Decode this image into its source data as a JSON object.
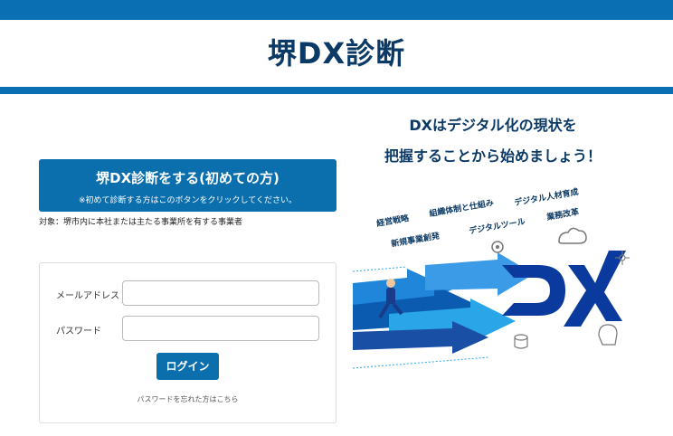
{
  "header": {
    "title": "堺DX診断"
  },
  "start": {
    "button_label": "堺DX診断をする(初めての方)",
    "button_sub": "※初めて診断する方はこのボタンをクリックしてください。",
    "target_note": "対象：堺市内に本社または主たる事業所を有する事業者"
  },
  "login": {
    "email_label": "メールアドレス",
    "password_label": "パスワード",
    "email_value": "",
    "password_value": "",
    "button_label": "ログイン",
    "forgot_link": "パスワードを忘れた方はこちら"
  },
  "promo": {
    "line1": "DXはデジタル化の現状を",
    "line2": "把握することから始めましょう！",
    "keywords": [
      "経営戦略",
      "組織体制と仕組み",
      "デジタル人材育成",
      "新規事業創発",
      "デジタルツール",
      "業務改革"
    ],
    "logo_text": "DX"
  },
  "colors": {
    "primary": "#0b6fad",
    "title": "#0b3a66",
    "accent_light": "#2aa6e8"
  }
}
